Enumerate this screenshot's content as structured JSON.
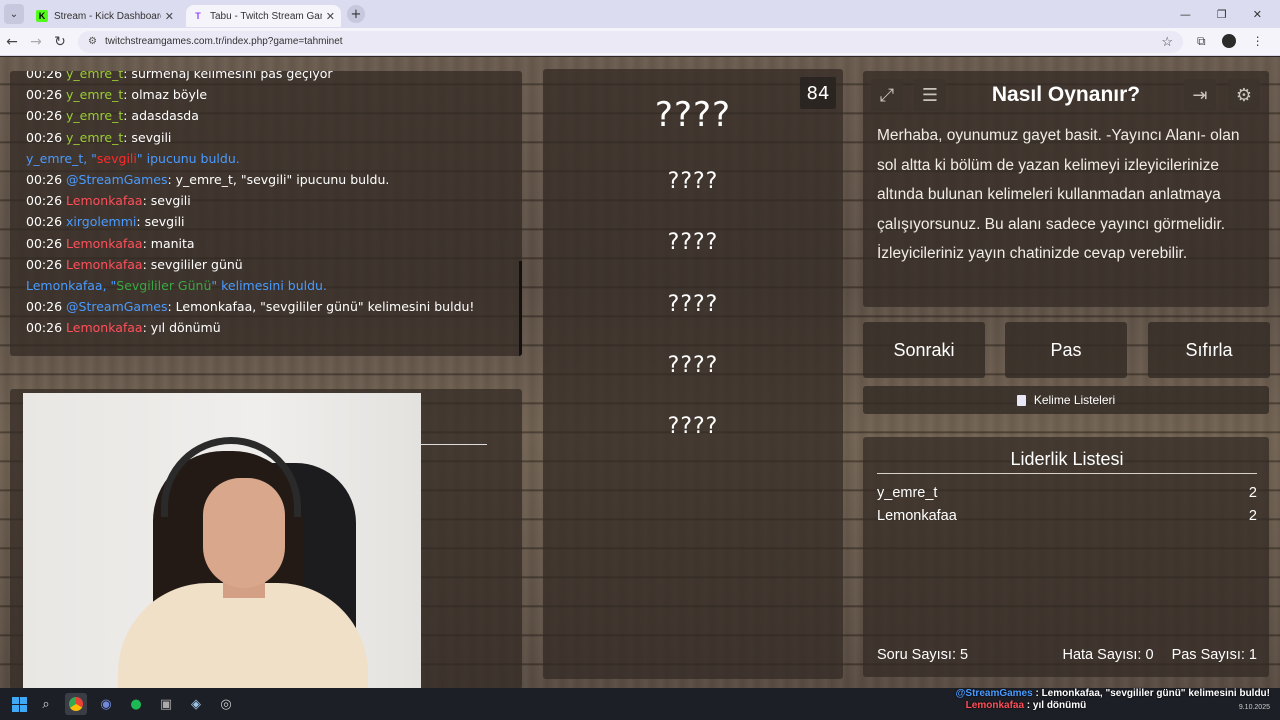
{
  "browser": {
    "tabs": [
      {
        "title": "Stream - Kick Dashboard",
        "active": false,
        "favicon": "K"
      },
      {
        "title": "Tabu - Twitch Stream Games",
        "active": true,
        "favicon": "T"
      }
    ],
    "url": "twitchstreamgames.com.tr/index.php?game=tahminet"
  },
  "chat": {
    "lines": [
      {
        "time": "00:26",
        "user": "y_emre_t",
        "user_color": "green",
        "text": ": sürmenaj kelimesini pas geçiyor"
      },
      {
        "time": "00:26",
        "user": "y_emre_t",
        "user_color": "green",
        "text": ": olmaz böyle"
      },
      {
        "time": "00:26",
        "user": "y_emre_t",
        "user_color": "green",
        "text": ": adasdasda"
      },
      {
        "time": "00:26",
        "user": "y_emre_t",
        "user_color": "green",
        "text": ": sevgili"
      },
      {
        "time": "",
        "user": "",
        "user_color": "",
        "text": ""
      },
      {
        "time": "00:26",
        "user": "@StreamGames",
        "user_color": "blue",
        "text": ": y_emre_t, \"sevgili\" ipucunu buldu."
      },
      {
        "time": "00:26",
        "user": "Lemonkafaa",
        "user_color": "red",
        "text": ": sevgili"
      },
      {
        "time": "00:26",
        "user": "xirgolemmi",
        "user_color": "blue",
        "text": ": sevgili"
      },
      {
        "time": "00:26",
        "user": "Lemonkafaa",
        "user_color": "red",
        "text": ": manita"
      },
      {
        "time": "00:26",
        "user": "Lemonkafaa",
        "user_color": "red",
        "text": ": sevgililer günü"
      },
      {
        "time": "",
        "user": "",
        "user_color": "",
        "text": ""
      },
      {
        "time": "00:26",
        "user": "@StreamGames",
        "user_color": "blue",
        "text": ": Lemonkafaa, \"sevgililer günü\" kelimesini buldu!"
      },
      {
        "time": "00:26",
        "user": "Lemonkafaa",
        "user_color": "red",
        "text": ": yıl dönümü"
      }
    ],
    "system1": {
      "pre": "y_emre_t, \"",
      "hl": "sevgili",
      "post": "\" ipucunu buldu."
    },
    "system2": {
      "pre": "Lemonkafaa, \"",
      "hl": "Sevgililer Günü",
      "post": "\" kelimesini buldu."
    }
  },
  "game": {
    "score": "84",
    "main_word": "????",
    "taboo_words": [
      "????",
      "????",
      "????",
      "????",
      "????"
    ]
  },
  "howto": {
    "title": "Nasıl Oynanır?",
    "text": "Merhaba, oyunumuz gayet basit. -Yayıncı Alanı- olan sol altta ki bölüm de yazan kelimeyi izleyicilerinize altında bulunan kelimeleri kullanmadan anlatmaya çalışıyorsunuz. Bu alanı sadece yayıncı görmelidir. İzleyicileriniz yayın chatinizde cevap verebilir."
  },
  "buttons": {
    "next": "Sonraki",
    "pass": "Pas",
    "reset": "Sıfırla",
    "wordlists": "Kelime Listeleri"
  },
  "leaderboard": {
    "title": "Liderlik Listesi",
    "rows": [
      {
        "name": "y_emre_t",
        "score": "2"
      },
      {
        "name": "Lemonkafaa",
        "score": "2"
      }
    ]
  },
  "stats": {
    "questions": "Soru Sayısı: 5",
    "errors": "Hata Sayısı: 0",
    "passes": "Pas Sayısı: 1"
  },
  "overlay": {
    "line1_user": "@StreamGames",
    "line1_text": " : Lemonkafaa, \"sevgililer günü\" kelimesini buldu!",
    "line2_user": "Lemonkafaa",
    "line2_text": " : yıl dönümü"
  },
  "taskbar": {
    "date": "9.10.2025"
  },
  "colors": {
    "green": "#9acd32",
    "red": "#ff4f5a",
    "blue": "#4a9bff"
  }
}
